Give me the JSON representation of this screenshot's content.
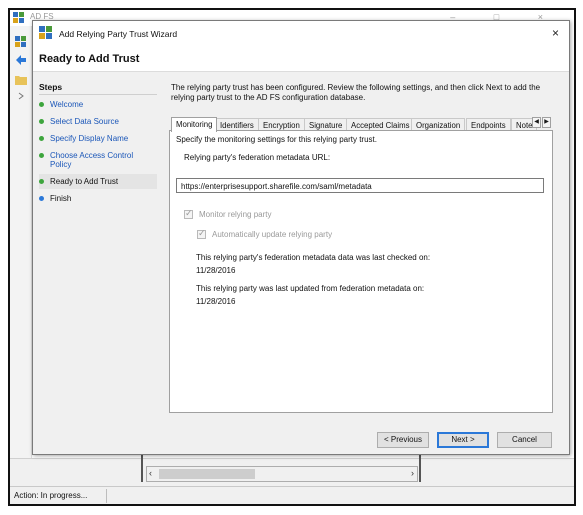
{
  "background_window": {
    "title": "AD FS",
    "controls": "–  □  ×",
    "status_text": "Action: In progress..."
  },
  "dialog": {
    "title": "Add Relying Party Trust Wizard",
    "close": "×",
    "heading": "Ready to Add Trust",
    "steps_label": "Steps",
    "steps": [
      {
        "label": "Welcome"
      },
      {
        "label": "Select Data Source"
      },
      {
        "label": "Specify Display Name"
      },
      {
        "label": "Choose Access Control Policy"
      },
      {
        "label": "Ready to Add Trust"
      },
      {
        "label": "Finish"
      }
    ],
    "intro": "The relying party trust has been configured.  Review the following settings, and then click Next to add the relying party trust to the AD FS configuration database.",
    "tabs": [
      "Monitoring",
      "Identifiers",
      "Encryption",
      "Signature",
      "Accepted Claims",
      "Organization",
      "Endpoints",
      "Note"
    ],
    "monitoring": {
      "description": "Specify the monitoring settings for this relying party trust.",
      "url_label": "Relying party's federation metadata URL:",
      "url_value": "https://enterprisesupport.sharefile.com/saml/metadata",
      "monitor_label": "Monitor relying party",
      "auto_update_label": "Automatically update relying party",
      "last_checked_label": "This relying party's federation metadata data was last checked on:",
      "last_checked_value": "11/28/2016",
      "last_updated_label": "This relying party was last updated from federation metadata on:",
      "last_updated_value": "11/28/2016"
    },
    "buttons": {
      "previous": "< Previous",
      "next": "Next >",
      "cancel": "Cancel"
    }
  },
  "colors": {
    "step_link": "#1a56b8",
    "step_done_dot": "#3da53d",
    "step_current_dot": "#2b78d8",
    "accent_border": "#2b78d8"
  }
}
